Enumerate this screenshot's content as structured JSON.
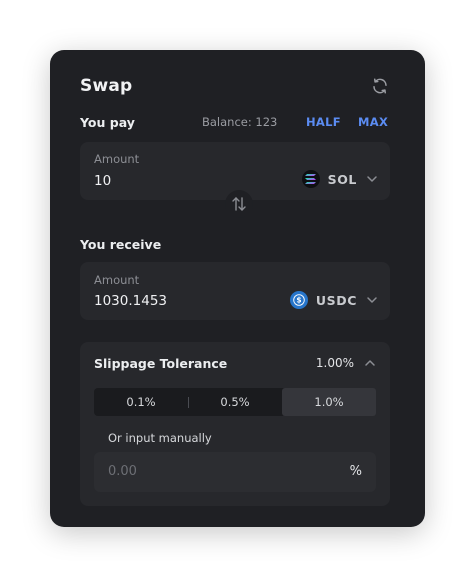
{
  "header": {
    "title": "Swap",
    "refresh_icon": "refresh-icon"
  },
  "pay": {
    "label": "You pay",
    "balance": "Balance: 123",
    "half_label": "HALF",
    "max_label": "MAX",
    "amount_label": "Amount",
    "amount_value": "10",
    "token_symbol": "SOL",
    "token_icon": "solana-icon"
  },
  "switch_icon": "swap-arrows-icon",
  "receive": {
    "label": "You receive",
    "amount_label": "Amount",
    "amount_value": "1030.1453",
    "token_symbol": "USDC",
    "token_icon": "usdc-icon"
  },
  "slippage": {
    "title": "Slippage Tolerance",
    "value": "1.00%",
    "options": [
      "0.1%",
      "0.5%",
      "1.0%"
    ],
    "selected": "1.0%",
    "manual_label": "Or input manually",
    "manual_placeholder": "0.00",
    "manual_unit": "%"
  },
  "colors": {
    "card_bg": "#1f2024",
    "panel_bg": "#27282c",
    "accent": "#5b8cf2",
    "usdc": "#2775ca"
  }
}
